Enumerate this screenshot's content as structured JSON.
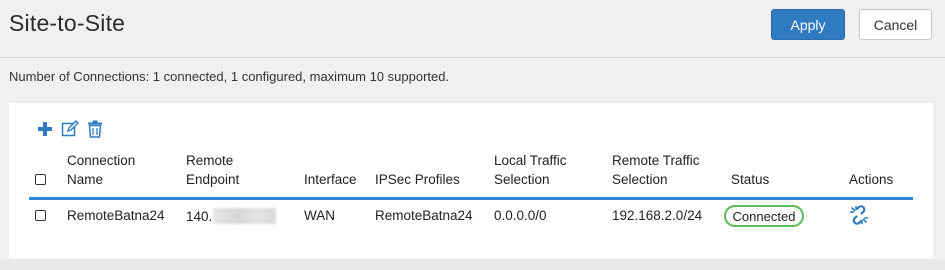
{
  "header": {
    "title": "Site-to-Site",
    "apply_label": "Apply",
    "cancel_label": "Cancel"
  },
  "summary": "Number of Connections: 1 connected, 1 configured, maximum 10 supported.",
  "toolbar": {
    "icons": [
      "add-icon",
      "edit-icon",
      "delete-icon"
    ]
  },
  "table": {
    "columns": {
      "connection_name": [
        "Connection",
        "Name"
      ],
      "remote_endpoint": [
        "Remote",
        "Endpoint"
      ],
      "interface": "Interface",
      "ipsec_profiles": "IPSec Profiles",
      "local_traffic": [
        "Local Traffic",
        "Selection"
      ],
      "remote_traffic": [
        "Remote Traffic",
        "Selection"
      ],
      "status": "Status",
      "actions": "Actions"
    },
    "rows": [
      {
        "connection_name": "RemoteBatna24",
        "remote_endpoint": "140.",
        "interface": "WAN",
        "ipsec_profile": "RemoteBatna24",
        "local_traffic": "0.0.0.0/0",
        "remote_traffic": "192.168.2.0/24",
        "status": "Connected",
        "action_icon": "disconnect-link-icon"
      }
    ]
  },
  "colors": {
    "primary": "#2f7bc2",
    "table_rule": "#2f86d6",
    "status_connected": "#5cb85c",
    "icon_blue": "#2f7bc2"
  }
}
